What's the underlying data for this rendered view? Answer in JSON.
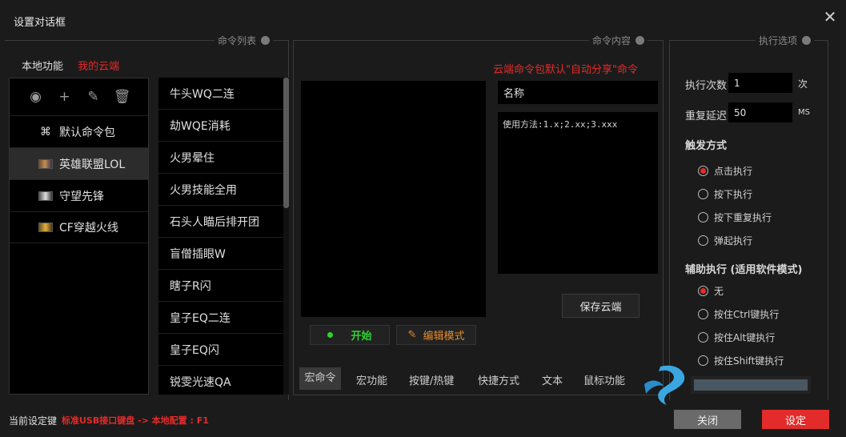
{
  "window": {
    "title": "设置对话框"
  },
  "panels": {
    "command_list": "命令列表",
    "command_content": "命令内容",
    "exec_options": "执行选项"
  },
  "top_tabs": {
    "local": "本地功能",
    "cloud": "我的云端"
  },
  "command_packs": [
    {
      "label": "默认命令包",
      "icon": "command-icon"
    },
    {
      "label": "英雄联盟LOL",
      "icon": "lol-thumb-icon"
    },
    {
      "label": "守望先锋",
      "icon": "ow-thumb-icon"
    },
    {
      "label": "CF穿越火线",
      "icon": "cf-thumb-icon"
    }
  ],
  "commands": [
    "牛头WQ二连",
    "劫WQE消耗",
    "火男晕住",
    "火男技能全用",
    "石头人瞄后排开团",
    "盲僧插眼W",
    "瞎子R闪",
    "皇子EQ二连",
    "皇子EQ闪",
    "锐雯光速QA"
  ],
  "content": {
    "cloud_notice": "云端命令包默认\"自动分享\"命令",
    "name_placeholder": "名称",
    "usage_text": "使用方法:1.x;2.xx;3.xxx",
    "save_cloud": "保存云端",
    "start": "开始",
    "edit_mode": "编辑模式"
  },
  "bottom_tabs": [
    "宏命令",
    "宏功能",
    "按键/热键",
    "快捷方式",
    "文本",
    "鼠标功能"
  ],
  "options": {
    "exec_count_label": "执行次数",
    "exec_count_value": "1",
    "exec_count_unit": "次",
    "repeat_delay_label": "重复延迟",
    "repeat_delay_value": "50",
    "repeat_delay_unit": "MS",
    "trigger_title": "触发方式",
    "triggers": [
      "点击执行",
      "按下执行",
      "按下重复执行",
      "弹起执行"
    ],
    "assist_title": "辅助执行 (适用软件模式)",
    "assists": [
      "无",
      "按住Ctrl键执行",
      "按住Alt键执行",
      "按住Shift键执行"
    ]
  },
  "status": {
    "label": "当前设定键",
    "value": "标准USB接口键盘 -> 本地配置 : F1"
  },
  "footer": {
    "close": "关闭",
    "confirm": "设定"
  },
  "colors": {
    "accent_red": "#e32b2b",
    "green": "#2fd22f",
    "orange": "#e38a2e"
  }
}
